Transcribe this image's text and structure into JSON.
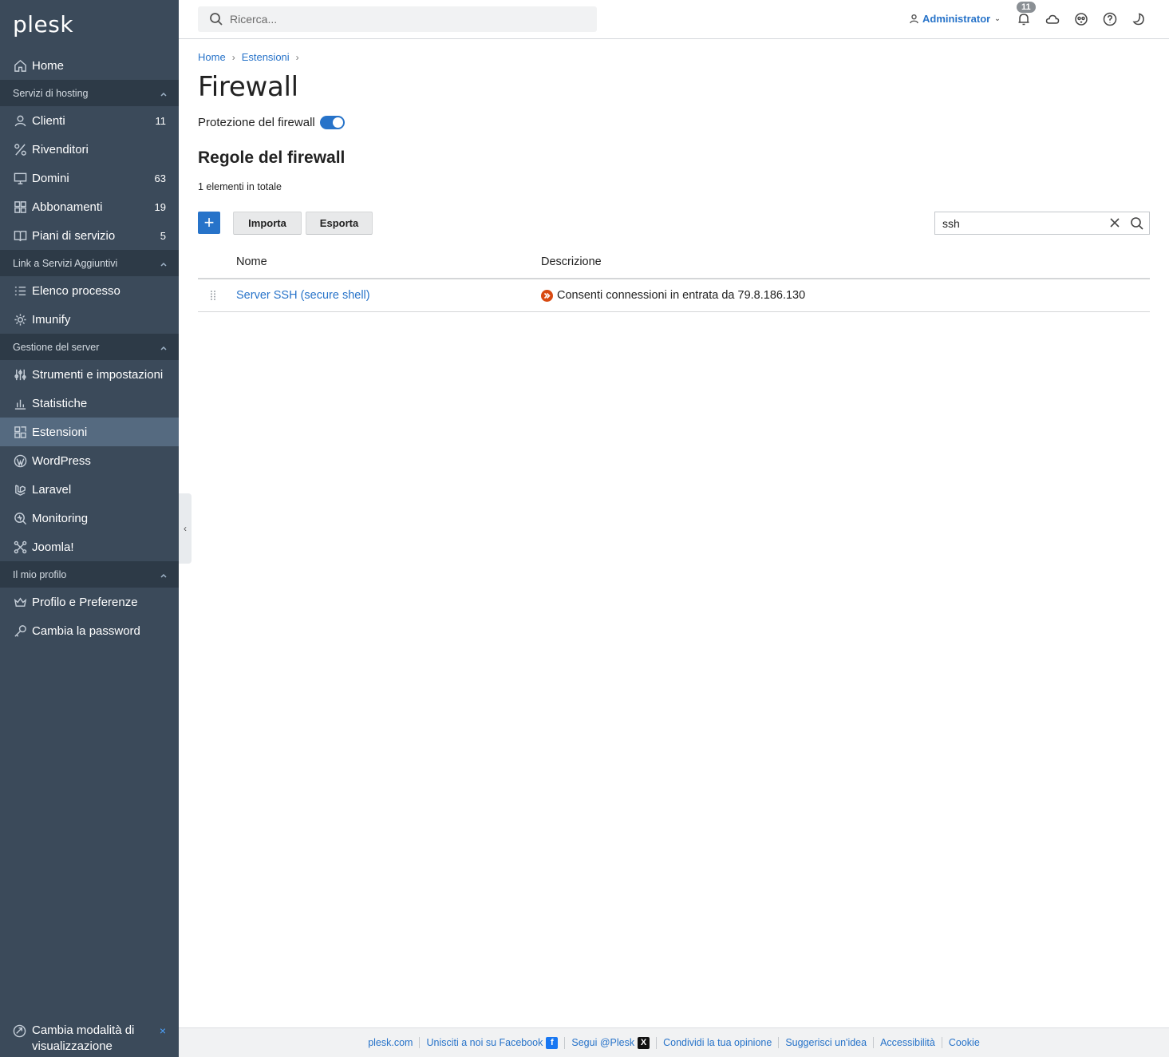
{
  "app": {
    "logo": "plesk"
  },
  "sidebar": {
    "home": "Home",
    "sections": [
      {
        "title": "Servizi di hosting",
        "items": [
          {
            "label": "Clienti",
            "count": "11",
            "icon": "user-icon"
          },
          {
            "label": "Rivenditori",
            "count": "",
            "icon": "percent-icon"
          },
          {
            "label": "Domini",
            "count": "63",
            "icon": "monitor-icon"
          },
          {
            "label": "Abbonamenti",
            "count": "19",
            "icon": "grid-icon"
          },
          {
            "label": "Piani di servizio",
            "count": "5",
            "icon": "book-icon"
          }
        ]
      },
      {
        "title": "Link a Servizi Aggiuntivi",
        "items": [
          {
            "label": "Elenco processo",
            "icon": "list-icon"
          },
          {
            "label": "Imunify",
            "icon": "gear-icon"
          }
        ]
      },
      {
        "title": "Gestione del server",
        "items": [
          {
            "label": "Strumenti e impostazioni",
            "icon": "sliders-icon"
          },
          {
            "label": "Statistiche",
            "icon": "bar-chart-icon"
          },
          {
            "label": "Estensioni",
            "icon": "extensions-icon",
            "active": true
          },
          {
            "label": "WordPress",
            "icon": "wordpress-icon"
          },
          {
            "label": "Laravel",
            "icon": "laravel-icon"
          },
          {
            "label": "Monitoring",
            "icon": "monitoring-icon"
          },
          {
            "label": "Joomla!",
            "icon": "joomla-icon"
          }
        ]
      },
      {
        "title": "Il mio profilo",
        "items": [
          {
            "label": "Profilo e Preferenze",
            "icon": "crown-icon"
          },
          {
            "label": "Cambia la password",
            "icon": "key-icon"
          }
        ]
      }
    ],
    "bottom": {
      "label": "Cambia modalità di visualizzazione",
      "close": "×"
    }
  },
  "topbar": {
    "search_placeholder": "Ricerca...",
    "user": "Administrator",
    "notifications_count": "11"
  },
  "breadcrumb": [
    "Home",
    "Estensioni"
  ],
  "page": {
    "title": "Firewall",
    "protection_label": "Protezione del firewall",
    "protection_on": true,
    "rules_title": "Regole del firewall",
    "total": "1 elementi in totale",
    "import_label": "Importa",
    "export_label": "Esporta",
    "filter_value": "ssh"
  },
  "table": {
    "columns": [
      "Nome",
      "Descrizione"
    ],
    "rows": [
      {
        "name": "Server SSH (secure shell)",
        "description": "Consenti connessioni in entrata da 79.8.186.130",
        "action": "allow"
      }
    ]
  },
  "footer": {
    "links": [
      "plesk.com",
      "Unisciti a noi su Facebook",
      "Segui @Plesk",
      "Condividi la tua opinione",
      "Suggerisci un'idea",
      "Accessibilità",
      "Cookie"
    ]
  },
  "colors": {
    "sidebar": "#3b4a5a",
    "accent": "#2773c9",
    "allow": "#d84a12"
  }
}
